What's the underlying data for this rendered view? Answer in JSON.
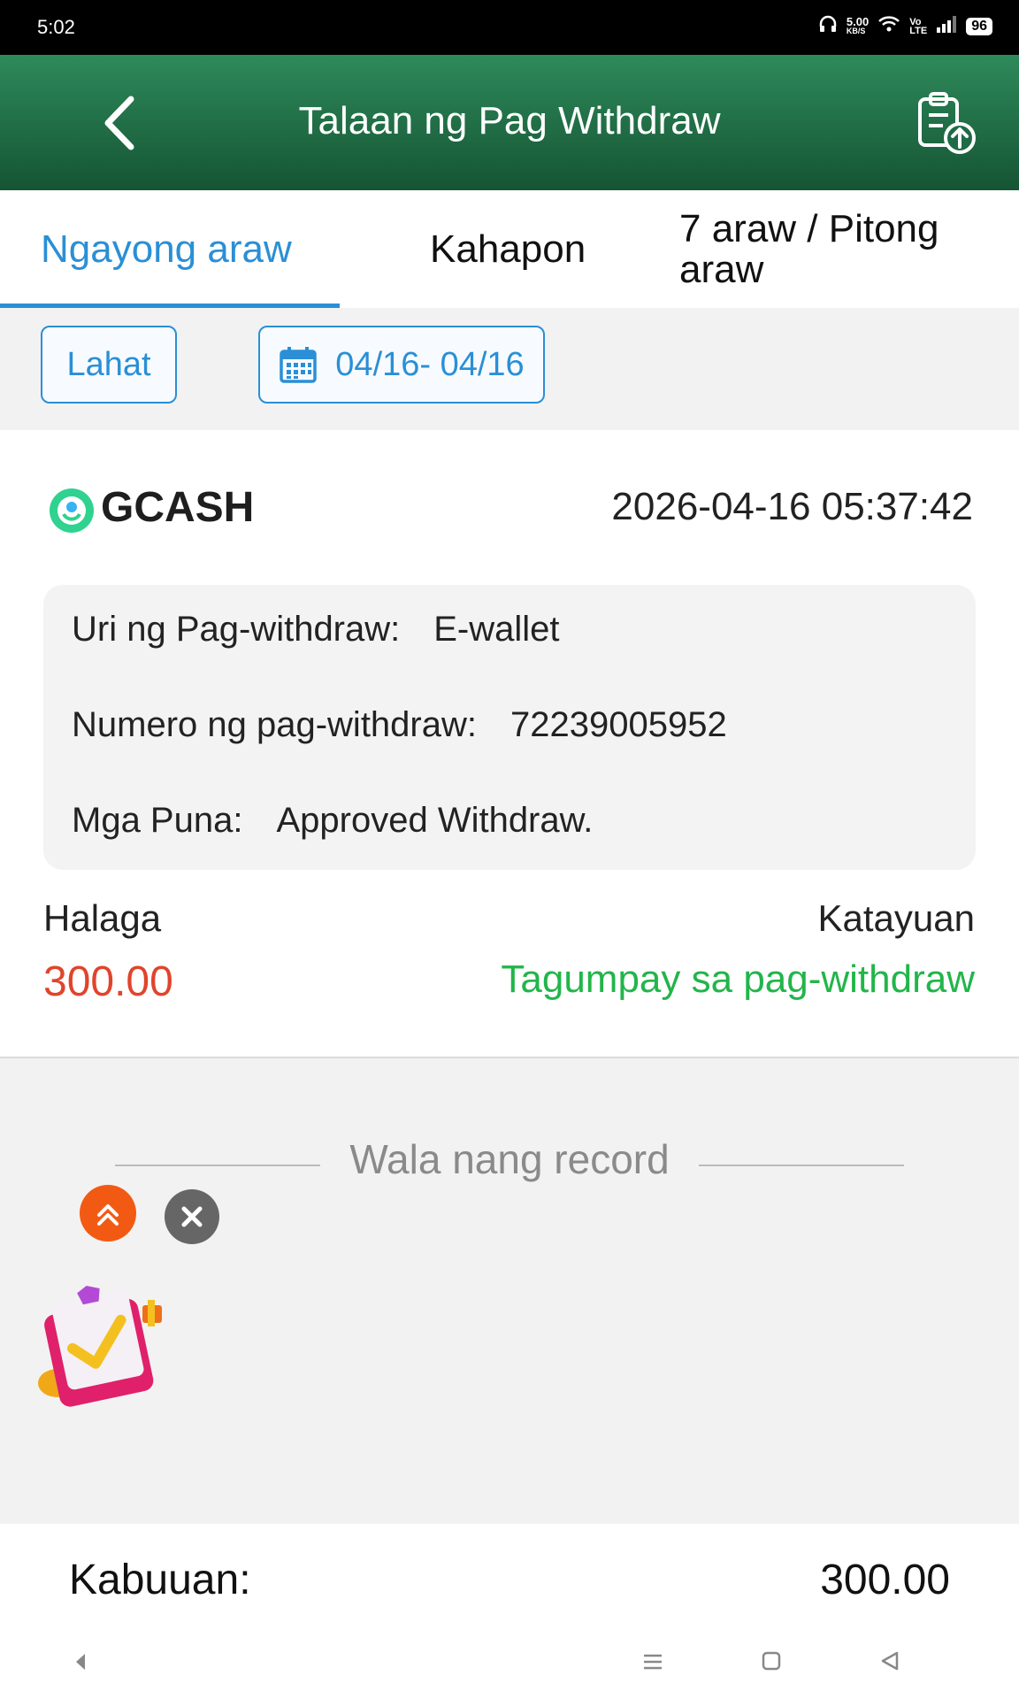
{
  "status_bar": {
    "time": "5:02",
    "speed": "5.00",
    "speed_unit": "KB/S",
    "battery": "96"
  },
  "header": {
    "title": "Talaan ng Pag Withdraw",
    "back_icon": "chevron-left-icon",
    "upload_icon": "clipboard-upload-icon"
  },
  "tabs": [
    {
      "label": "Ngayong araw",
      "active": true
    },
    {
      "label": "Kahapon",
      "active": false
    },
    {
      "label": "7 araw / Pitong araw",
      "active": false
    }
  ],
  "filter": {
    "all_label": "Lahat",
    "date_range": "04/16- 04/16",
    "calendar_icon": "calendar-icon"
  },
  "record": {
    "provider": "GCASH",
    "datetime": "2026-04-16 05:37:42",
    "details": [
      {
        "label": "Uri ng Pag-withdraw:",
        "value": "E-wallet"
      },
      {
        "label": "Numero ng pag-withdraw:",
        "value": "72239005952"
      },
      {
        "label": "Mga Puna:",
        "value": "Approved Withdraw."
      }
    ],
    "amount_label": "Halaga",
    "amount": "300.00",
    "status_label": "Katayuan",
    "status": "Tagumpay sa pag-withdraw"
  },
  "no_record": "Wala nang record",
  "total": {
    "label": "Kabuuan:",
    "value": "300.00"
  },
  "colors": {
    "header_top": "#2e8a5a",
    "header_bottom": "#155434",
    "accent": "#2a8fd6",
    "amount": "#e0442c",
    "status": "#22b54a"
  }
}
